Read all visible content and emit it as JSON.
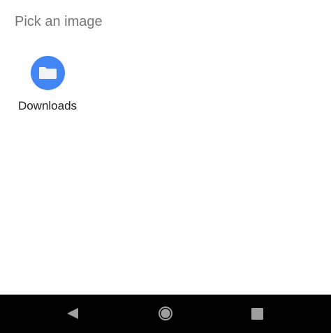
{
  "dialog": {
    "title": "Pick an image"
  },
  "apps": [
    {
      "label": "Downloads",
      "icon": "folder-icon",
      "icon_bg": "#4285F4",
      "icon_fg": "#F1F3F4"
    }
  ],
  "nav_bar": {
    "background": "#000000",
    "buttons": [
      {
        "icon": "back-triangle-icon"
      },
      {
        "icon": "home-circle-icon"
      },
      {
        "icon": "recents-square-icon"
      }
    ]
  }
}
